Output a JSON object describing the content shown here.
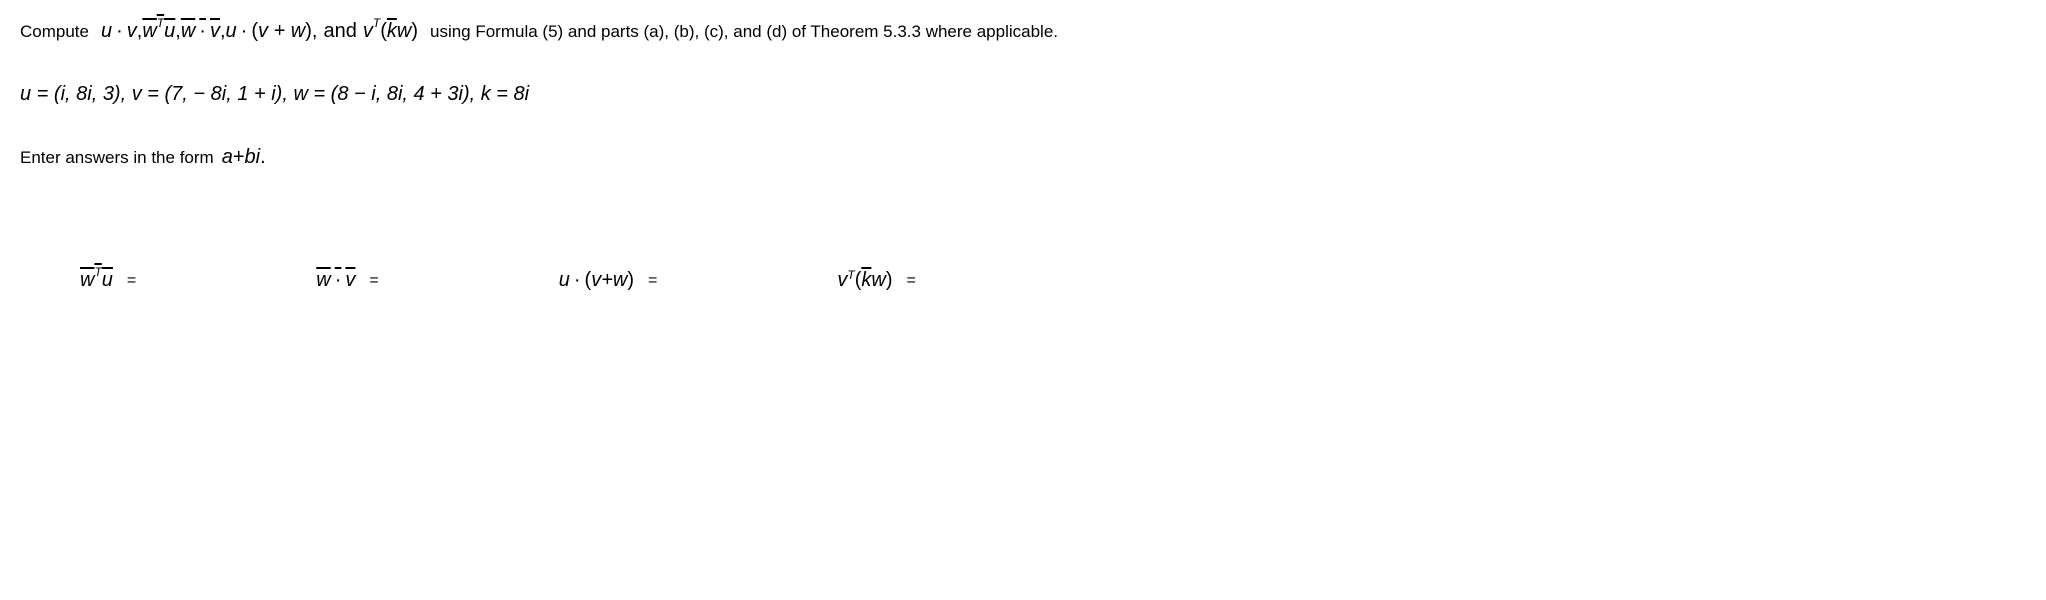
{
  "line1": {
    "prefix": "Compute",
    "expr_and": "and",
    "suffix": "using Formula (5) and parts (a), (b), (c), and (d) of Theorem 5.3.3 where applicable."
  },
  "vectors": {
    "def": "u = (i, 8i, 3), v = (7,  − 8i, 1 + i), w = (8 − i, 8i, 4 + 3i), k = 8i"
  },
  "line3": {
    "prefix": "Enter answers in the form",
    "form_a": "a",
    "form_plus": " + ",
    "form_b": "b",
    "form_i": "i",
    "period": " ."
  },
  "answers": {
    "eq": "="
  },
  "math": {
    "u": "u",
    "v": "v",
    "w": "w",
    "k": "k",
    "T": "T",
    "dot": "·",
    "comma": ", ",
    "plus": " + ",
    "lparen": "(",
    "rparen": ")"
  }
}
